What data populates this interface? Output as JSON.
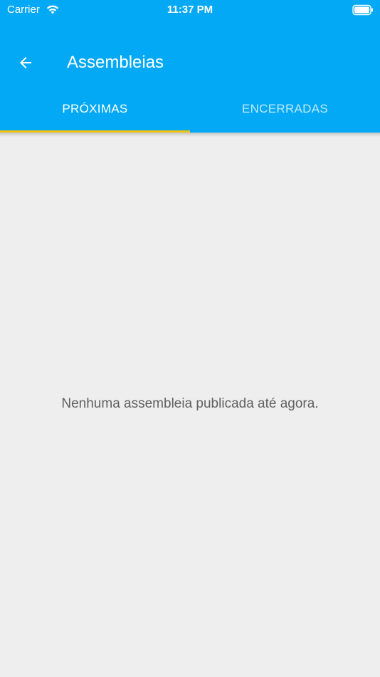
{
  "status_bar": {
    "carrier": "Carrier",
    "time": "11:37 PM"
  },
  "toolbar": {
    "title": "Assembleias",
    "back_icon": "arrow-left-icon"
  },
  "tabs": [
    {
      "label": "PRÓXIMAS",
      "active": true
    },
    {
      "label": "ENCERRADAS",
      "active": false
    }
  ],
  "content": {
    "empty_message": "Nenhuma assembleia publicada até agora."
  },
  "colors": {
    "primary": "#03a9f4",
    "indicator": "#f4c20d",
    "background": "#eeeeee",
    "message_text": "#606060"
  }
}
